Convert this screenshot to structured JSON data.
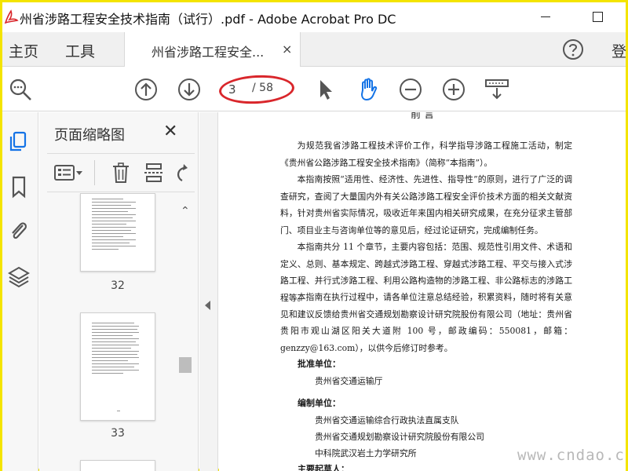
{
  "window": {
    "title": "州省涉路工程安全技术指南（试行）.pdf - Adobe Acrobat Pro DC"
  },
  "tabs": {
    "home": "主页",
    "tools": "工具",
    "document": "州省涉路工程安全...",
    "close": "×",
    "signin": "登"
  },
  "toolbar": {
    "page_current": "3",
    "page_total": "/ 58",
    "highlight_color": "#d9262b",
    "accent_color": "#1473e6"
  },
  "thumbnails": {
    "title": "页面缩略图",
    "close": "✕",
    "pages": [
      {
        "number": "32"
      },
      {
        "number": "33"
      }
    ]
  },
  "document": {
    "heading": "前  言",
    "paragraphs": [
      "为规范我省涉路工程技术评价工作，科学指导涉路工程施工活动，制定《贵州省公路涉路工程安全技术指南》（简称“本指南”）。",
      "本指南按照“适用性、经济性、先进性、指导性”的原则，进行了广泛的调查研究，查阅了大量国内外有关公路涉路工程安全评价技术方面的相关文献资料，针对贵州省实际情况，吸收近年来国内相关研究成果，在充分征求主管部门、项目业主与咨询单位等的意见后，经过论证研究，完成编制任务。",
      "本指南共分 11 个章节，主要内容包括：范围、规范性引用文件、术语和定义、总则、基本规定、跨越式涉路工程、穿越式涉路工程、平交与接入式涉路工程、并行式涉路工程、利用公路构造物的涉路工程、非公路标志的涉路工程等。",
      "本指南在执行过程中，请各单位注意总结经验，积累资料，随时将有关意见和建议反馈给贵州省交通规划勘察设计研究院股份有限公司（地址：贵州省贵阳市观山湖区阳关大道附 100 号，邮政编码：550081，邮箱：genzzy@163.com），以供今后修订时参考。"
    ],
    "approval_label": "批准单位：",
    "approval_orgs": [
      "贵州省交通运输厅"
    ],
    "editor_label": "编制单位：",
    "editor_orgs": [
      "贵州省交通运输综合行政执法直属支队",
      "贵州省交通规划勘察设计研究院股份有限公司",
      "中科院武汉岩土力学研究所"
    ],
    "drafter_label": "主要起草人："
  },
  "watermark": "www.cndao.com"
}
